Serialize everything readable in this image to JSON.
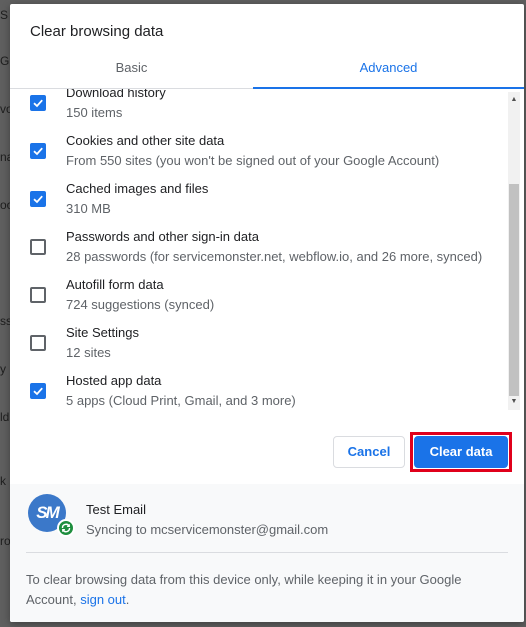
{
  "background_page": {
    "visible_letters": [
      "S",
      "G",
      "vo",
      "na",
      "oo",
      "ss",
      "y",
      "ld",
      "k",
      "ro"
    ]
  },
  "dialog": {
    "title": "Clear browsing data",
    "tabs": [
      {
        "label": "Basic",
        "selected": false
      },
      {
        "label": "Advanced",
        "selected": true
      }
    ],
    "items": [
      {
        "title": "Download history",
        "detail": "150 items",
        "checked": true
      },
      {
        "title": "Cookies and other site data",
        "detail": "From 550 sites (you won't be signed out of your Google Account)",
        "checked": true
      },
      {
        "title": "Cached images and files",
        "detail": "310 MB",
        "checked": true
      },
      {
        "title": "Passwords and other sign-in data",
        "detail": "28 passwords (for servicemonster.net, webflow.io, and 26 more, synced)",
        "checked": false
      },
      {
        "title": "Autofill form data",
        "detail": "724 suggestions (synced)",
        "checked": false
      },
      {
        "title": "Site Settings",
        "detail": "12 sites",
        "checked": false
      },
      {
        "title": "Hosted app data",
        "detail": "5 apps (Cloud Print, Gmail, and 3 more)",
        "checked": true
      }
    ],
    "buttons": {
      "cancel": "Cancel",
      "clear": "Clear data"
    },
    "account": {
      "name": "Test Email",
      "sync_text": "Syncing to mcservicemonster@gmail.com",
      "avatar_letters": "SM"
    },
    "footer_note": {
      "text": "To clear browsing data from this device only, while keeping it in your Google Account,",
      "link": "sign out",
      "end": "."
    },
    "colors": {
      "accent": "#1a73e8",
      "highlight_frame": "#e0001b",
      "sync_badge": "#1e8e3e"
    }
  }
}
